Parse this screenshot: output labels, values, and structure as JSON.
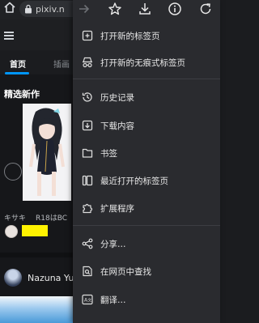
{
  "browser": {
    "url_text": "pixiv.n",
    "menu_topbar": {
      "icons": [
        "forward-icon",
        "star-icon",
        "download-icon",
        "info-icon",
        "refresh-icon"
      ]
    }
  },
  "page": {
    "tabs": [
      "首页",
      "插画"
    ],
    "section_title": "精选新作",
    "work_author": "キサキ",
    "work_tag": "R18はBC",
    "user_name": "Nazuna Yu"
  },
  "menu": {
    "items": [
      {
        "label": "打开新的标签页",
        "icon": "new-tab-icon"
      },
      {
        "label": "打开新的无痕式标签页",
        "icon": "incognito-icon"
      },
      {
        "label": "历史记录",
        "icon": "history-icon"
      },
      {
        "label": "下载内容",
        "icon": "downloads-icon"
      },
      {
        "label": "书签",
        "icon": "bookmarks-icon"
      },
      {
        "label": "最近打开的标签页",
        "icon": "recent-tabs-icon"
      },
      {
        "label": "扩展程序",
        "icon": "extensions-icon"
      },
      {
        "label": "分享…",
        "icon": "share-icon"
      },
      {
        "label": "在网页中查找",
        "icon": "find-in-page-icon"
      },
      {
        "label": "翻译…",
        "icon": "translate-icon"
      }
    ]
  },
  "colors": {
    "accent_blue": "#0096fa",
    "menu_bg": "#2a2b2f",
    "highlight_yellow": "#fff200"
  }
}
